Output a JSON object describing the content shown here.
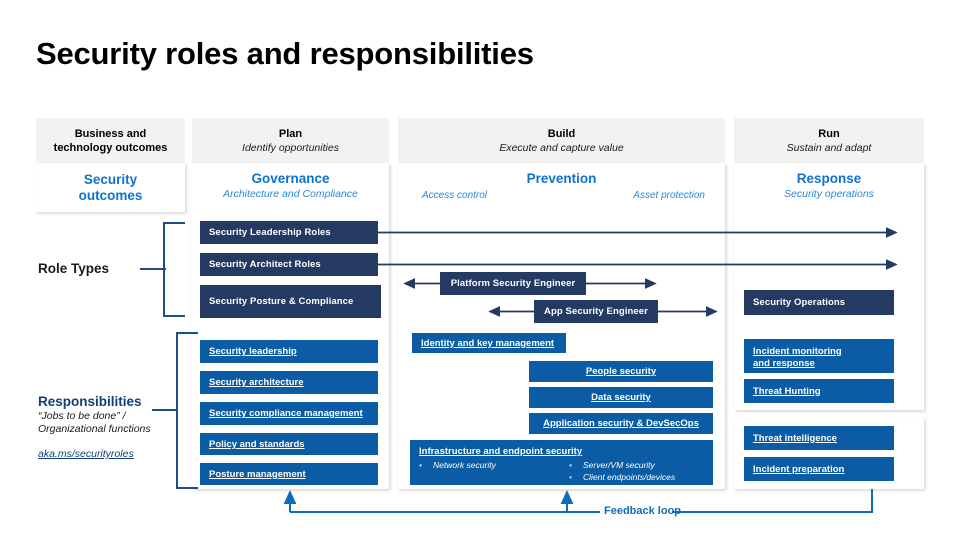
{
  "title": "Security roles and responsibilities",
  "phases": [
    {
      "name": "phase-business",
      "title": "Business and",
      "title2": "technology outcomes",
      "sub": ""
    },
    {
      "name": "phase-plan",
      "title": "Plan",
      "sub": "Identify opportunities"
    },
    {
      "name": "phase-build",
      "title": "Build",
      "sub": "Execute and capture value"
    },
    {
      "name": "phase-run",
      "title": "Run",
      "sub": "Sustain and adapt"
    }
  ],
  "outcomes": {
    "business": {
      "line1": "Security",
      "line2": "outcomes"
    },
    "plan": {
      "title": "Governance",
      "sub": "Architecture and Compliance"
    },
    "build": {
      "title": "Prevention",
      "left": "Access control",
      "right": "Asset protection"
    },
    "run": {
      "title": "Response",
      "sub": "Security operations"
    }
  },
  "row_labels": {
    "role_types": "Role Types",
    "responsibilities": "Responsibilities",
    "responsibilities_sub1": "“Jobs to be done” /",
    "responsibilities_sub2": "Organizational functions",
    "link": "aka.ms/securityroles"
  },
  "role_types": {
    "plan": [
      "Security Leadership Roles",
      "Security Architect Roles",
      "Security Posture & Compliance"
    ],
    "build": [
      "Platform Security Engineer",
      "App Security Engineer"
    ],
    "run": [
      "Security Operations"
    ]
  },
  "responsibilities": {
    "plan": [
      "Security leadership",
      "Security architecture",
      "Security compliance management",
      "Policy and standards",
      "Posture management"
    ],
    "build": {
      "identity": "Identity and key management",
      "people": "People security",
      "data": "Data security",
      "appsec": "Application security & DevSecOps",
      "infra": {
        "title": "Infrastructure and endpoint security",
        "col1": [
          "Network security"
        ],
        "col2": [
          "Server/VM security",
          "Client endpoints/devices"
        ]
      }
    },
    "run_top": [
      {
        "line1": "Incident monitoring",
        "line2": "and response"
      },
      {
        "line1": "Threat Hunting",
        "line2": ""
      }
    ],
    "run_bottom": [
      "Threat intelligence",
      "Incident preparation"
    ]
  },
  "feedback": {
    "label": "Feedback loop"
  },
  "colors": {
    "navy": "#243a63",
    "blue": "#0b5ca4",
    "accent": "#0f72d1",
    "accent_light": "#2b87d6",
    "header_bg": "#f2f2f2",
    "bracket": "#1f4e86"
  }
}
